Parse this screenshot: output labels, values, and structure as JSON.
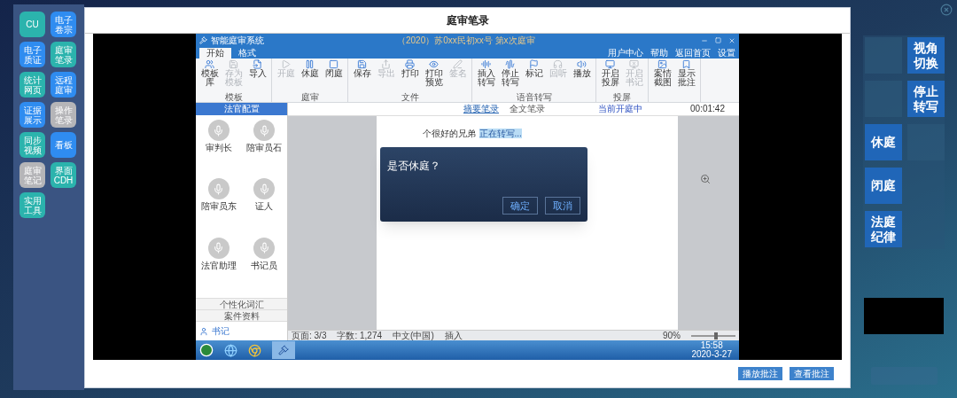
{
  "left_apps": [
    {
      "label": "CU",
      "color": "#2bb3ad",
      "disabled": false
    },
    {
      "label": "电子卷宗",
      "color": "#2f8cf0",
      "disabled": false
    },
    {
      "label": "电子质证",
      "color": "#2f8cf0",
      "disabled": false
    },
    {
      "label": "庭审笔录",
      "color": "#2bb3ad",
      "disabled": false
    },
    {
      "label": "统计网页",
      "color": "#2bb3ad",
      "disabled": false
    },
    {
      "label": "远程庭审",
      "color": "#2f8cf0",
      "disabled": false
    },
    {
      "label": "证据展示",
      "color": "#2f8cf0",
      "disabled": false
    },
    {
      "label": "操作笔录",
      "disabled": true
    },
    {
      "label": "同步视频",
      "color": "#2bb3ad",
      "disabled": false
    },
    {
      "label": "看板",
      "color": "#2f8cf0",
      "disabled": false
    },
    {
      "label": "庭审笔记",
      "disabled": true
    },
    {
      "label": "界面CDH",
      "color": "#2bb3ad",
      "disabled": false
    },
    {
      "label": "实用工具",
      "color": "#2bb3ad",
      "disabled": false
    }
  ],
  "dialog": {
    "title": "庭审笔录",
    "footer_buttons": [
      "播放批注",
      "查看批注"
    ]
  },
  "app": {
    "title": "智能庭审系统",
    "case_number": "（2020）苏0xx民初xx号 第x次庭审",
    "tabs": [
      {
        "label": "开始",
        "selected": true
      },
      {
        "label": "格式",
        "selected": false
      }
    ],
    "top_links": [
      "用户中心",
      "帮助",
      "返回首页",
      "设置"
    ],
    "ribbon_groups": [
      {
        "label": "模板",
        "items": [
          {
            "label": "模板库",
            "disabled": false
          },
          {
            "label": "存为模板",
            "disabled": true
          },
          {
            "label": "导入",
            "disabled": false
          }
        ]
      },
      {
        "label": "庭审",
        "items": [
          {
            "label": "开庭",
            "disabled": true
          },
          {
            "label": "休庭",
            "disabled": false
          },
          {
            "label": "闭庭",
            "disabled": false
          }
        ]
      },
      {
        "label": "文件",
        "items": [
          {
            "label": "保存",
            "disabled": false
          },
          {
            "label": "导出",
            "disabled": true
          },
          {
            "label": "打印",
            "disabled": false
          },
          {
            "label": "打印预览",
            "disabled": false
          },
          {
            "label": "签名",
            "disabled": true
          }
        ]
      },
      {
        "label": "语音转写",
        "items": [
          {
            "label": "插入转写",
            "disabled": false
          },
          {
            "label": "停止转写",
            "disabled": false
          },
          {
            "label": "标记",
            "disabled": false
          },
          {
            "label": "回听",
            "disabled": true
          },
          {
            "label": "播放",
            "disabled": false
          }
        ]
      },
      {
        "label": "投屏",
        "items": [
          {
            "label": "开启投屏",
            "disabled": false
          },
          {
            "label": "开启书记",
            "disabled": true
          }
        ]
      },
      {
        "items": [
          {
            "label": "案情截图",
            "disabled": false
          },
          {
            "label": "显示批注",
            "disabled": false
          }
        ]
      }
    ],
    "sidebar": {
      "header": "法官配置",
      "mics": [
        "审判长",
        "陪审员石",
        "陪审员东",
        "证人",
        "法官助理",
        "书记员"
      ],
      "sections": [
        "个性化词汇",
        "案件资料"
      ],
      "user": "书记"
    },
    "doc_tabs": [
      {
        "label": "摘要笔录",
        "selected": true
      },
      {
        "label": "全文笔录",
        "selected": false
      }
    ],
    "session_status": "当前开庭中",
    "timer": "00:01:42",
    "page_text": "个很好的兄弟",
    "transcribing": "正在转写...",
    "confirm": {
      "message": "是否休庭？",
      "buttons": [
        "确定",
        "取消"
      ]
    },
    "status_bar": [
      "页面: 3/3",
      "字数: 1,274",
      "中文(中国)",
      "插入"
    ],
    "zoom": "90%",
    "zoom_slider": {
      "level": 0.55
    },
    "clock": {
      "time": "15:58",
      "date": "2020-3-27"
    }
  },
  "right_buttons": [
    "视角切换",
    "停止转写",
    "休庭",
    "闭庭",
    "法庭纪律"
  ]
}
